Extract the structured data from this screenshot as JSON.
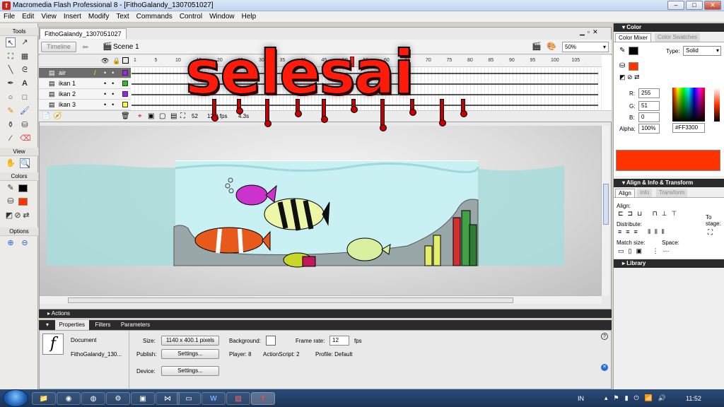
{
  "window": {
    "title": "Macromedia Flash Professional 8 - [FithoGalandy_1307051027]",
    "controls": [
      "–",
      "□",
      "✕"
    ]
  },
  "menu": [
    "File",
    "Edit",
    "View",
    "Insert",
    "Modify",
    "Text",
    "Commands",
    "Control",
    "Window",
    "Help"
  ],
  "document": {
    "tab": "FithoGalandy_1307051027",
    "timeline_button": "Timeline",
    "scene": "Scene 1",
    "zoom": "50%"
  },
  "tools_panel": {
    "tools_label": "Tools",
    "view_label": "View",
    "colors_label": "Colors",
    "options_label": "Options"
  },
  "layers": [
    {
      "name": "air",
      "color": "#a020f0",
      "active": true
    },
    {
      "name": "ikan 1",
      "color": "#22c322",
      "active": false
    },
    {
      "name": "ikan 2",
      "color": "#a020f0",
      "active": false
    },
    {
      "name": "ikan 3",
      "color": "#ffff33",
      "active": false
    }
  ],
  "frame_numbers": [
    "1",
    "5",
    "10",
    "15",
    "20",
    "25",
    "30",
    "35",
    "40",
    "45",
    "50",
    "55",
    "60",
    "65",
    "70",
    "75",
    "80",
    "85",
    "90",
    "95",
    "100",
    "105"
  ],
  "timeline_footer": {
    "current_frame": "52",
    "fps": "12.0 fps",
    "time": "4.3s"
  },
  "overlay_text": "selesai",
  "panels": {
    "actions": "Actions",
    "props_tabs": [
      "Properties",
      "Filters",
      "Parameters"
    ],
    "properties": {
      "type": "Document",
      "name": "FithoGalandy_130...",
      "size_label": "Size:",
      "size_value": "1140 x 400.1 pixels",
      "background_label": "Background:",
      "frame_rate_label": "Frame rate:",
      "frame_rate_value": "12",
      "fps_label": "fps",
      "publish_label": "Publish:",
      "settings_button": "Settings...",
      "player_label": "Player: 8",
      "actionscript_label": "ActionScript: 2",
      "profile_label": "Profile: Default",
      "device_label": "Device:",
      "device_settings_button": "Settings..."
    }
  },
  "color_panel": {
    "title": "Color",
    "tabs": [
      "Color Mixer",
      "Color Swatches"
    ],
    "type_label": "Type:",
    "type_value": "Solid",
    "r_label": "R:",
    "r": "255",
    "g_label": "G:",
    "g": "51",
    "b_label": "B:",
    "b": "0",
    "alpha_label": "Alpha:",
    "alpha": "100%",
    "hex": "#FF3300",
    "fill_color": "#ff3300"
  },
  "align_panel": {
    "title": "Align & Info & Transform",
    "tabs": [
      "Align",
      "Info",
      "Transform"
    ],
    "align_label": "Align:",
    "distribute_label": "Distribute:",
    "match_size_label": "Match size:",
    "space_label": "Space:",
    "to_stage_label": "To stage:"
  },
  "library_panel": {
    "title": "Library"
  },
  "taskbar": {
    "lang": "IN",
    "time": "11:52"
  }
}
